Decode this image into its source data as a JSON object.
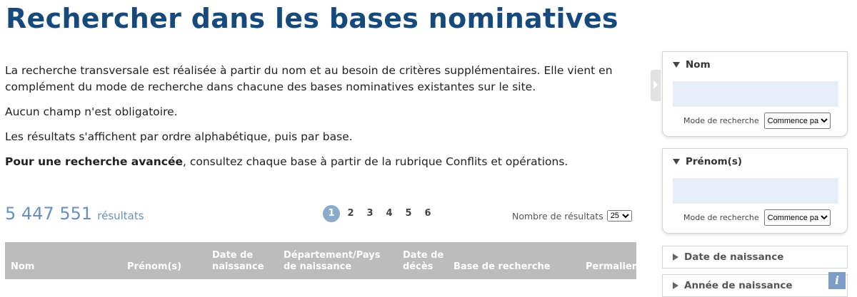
{
  "title": "Rechercher dans les bases nominatives",
  "intro": {
    "p1": "La recherche transversale est réalisée à partir du nom et au besoin de critères supplémentaires. Elle vient en complément du mode de recherche dans chacune des bases nominatives existantes sur le site.",
    "p2": "Aucun champ n'est obligatoire.",
    "p3": "Les résultats s'affichent par ordre alphabétique, puis par base.",
    "p4_bold": "Pour une recherche avancée",
    "p4_mid": ", consultez chaque base à partir de la ",
    "p4_link": "rubrique Conflits et opérations",
    "p4_end": "."
  },
  "results": {
    "count": "5 447 551",
    "label": "résultats"
  },
  "pagination": {
    "pages": [
      "1",
      "2",
      "3",
      "4",
      "5",
      "6"
    ],
    "active": "1"
  },
  "per_page": {
    "label": "Nombre de résultats",
    "value": "25"
  },
  "table": {
    "columns": [
      "Nom",
      "Prénom(s)",
      "Date de naissance",
      "Département/Pays de naissance",
      "Date de décès",
      "Base de recherche",
      "Permalien"
    ]
  },
  "sidebar": {
    "nom": {
      "title": "Nom",
      "value": "",
      "mode_label": "Mode de recherche",
      "mode_value": "Commence par"
    },
    "prenom": {
      "title": "Prénom(s)",
      "value": "",
      "mode_label": "Mode de recherche",
      "mode_value": "Commence par"
    },
    "date_naissance": {
      "title": "Date de naissance"
    },
    "annee_naissance": {
      "title": "Année de naissance"
    }
  },
  "colors": {
    "title": "#174a7c",
    "results": "#6b8fbf",
    "active_page": "#8aabc9",
    "table_header": "#bcbcbc",
    "input_bg": "#e6eefa",
    "info_icon": "#7d9cc8"
  },
  "icons": {
    "collapse_handle": "chevron-right-icon",
    "expanded": "triangle-down-icon",
    "collapsed": "triangle-right-icon",
    "info": "info-icon"
  }
}
